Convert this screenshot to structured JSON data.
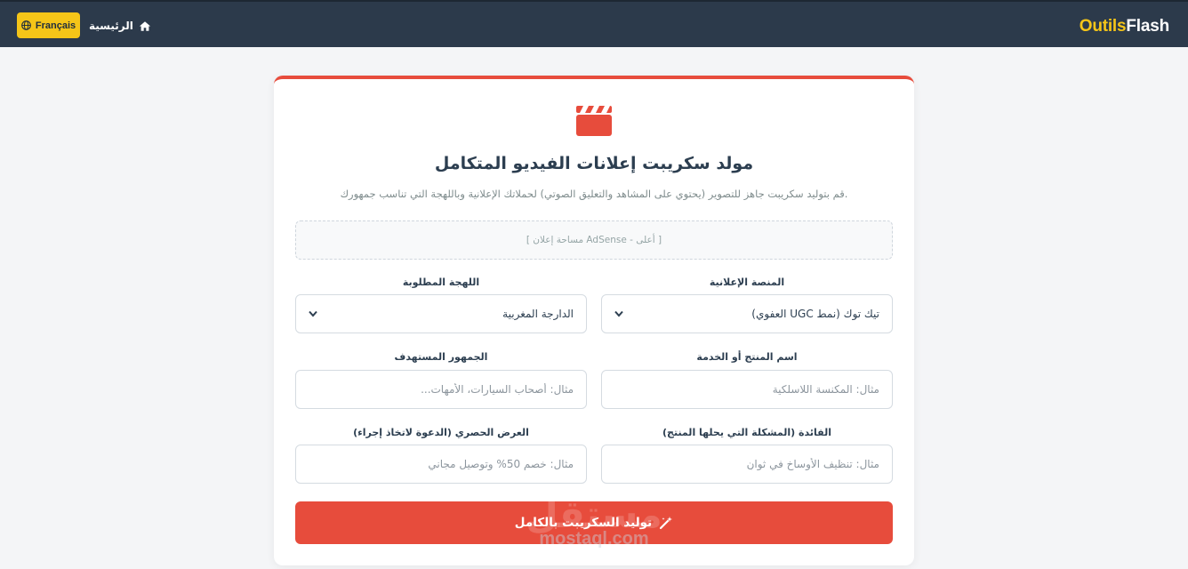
{
  "header": {
    "brand_part1": "Outils",
    "brand_part2": "Flash",
    "language_button": "Français",
    "home_link": "الرئيسية"
  },
  "main": {
    "title": "مولد سكريبت إعلانات الفيديو المتكامل",
    "subtitle": "قم بتوليد سكريبت جاهز للتصوير (يحتوي على المشاهد والتعليق الصوتي) لحملاتك الإعلانية وباللهجة التي تناسب جمهورك.",
    "ad_placeholder": "[ مساحة إعلان AdSense - أعلى ]"
  },
  "form": {
    "platform": {
      "label": "المنصة الإعلانية",
      "value": "تيك توك (نمط UGC العفوي)"
    },
    "dialect": {
      "label": "اللهجة المطلوبة",
      "value": "الدارجة المغربية"
    },
    "product": {
      "label": "اسم المنتج أو الخدمة",
      "placeholder": "مثال: المكنسة اللاسلكية"
    },
    "audience": {
      "label": "الجمهور المستهدف",
      "placeholder": "مثال: أصحاب السيارات، الأمهات..."
    },
    "benefit": {
      "label": "الفائدة (المشكلة التي يحلها المنتج)",
      "placeholder": "مثال: تنظيف الأوساخ في ثوانٍ"
    },
    "offer": {
      "label": "العرض الحصري (الدعوة لاتخاذ إجراء)",
      "placeholder": "مثال: خصم 50% وتوصيل مجاني"
    },
    "submit_label": "توليد السكريبت بالكامل"
  },
  "watermark": {
    "arabic": "مستقل",
    "latin": "mostaql.com"
  },
  "colors": {
    "accent": "#e74c3c",
    "brand_yellow": "#f5c518",
    "header_bg": "#2c3a4b"
  },
  "icons": {
    "language": "globe-icon",
    "home": "home-icon",
    "hero": "clapperboard-icon",
    "submit": "magic-wand-icon",
    "select": "chevron-down-icon"
  }
}
